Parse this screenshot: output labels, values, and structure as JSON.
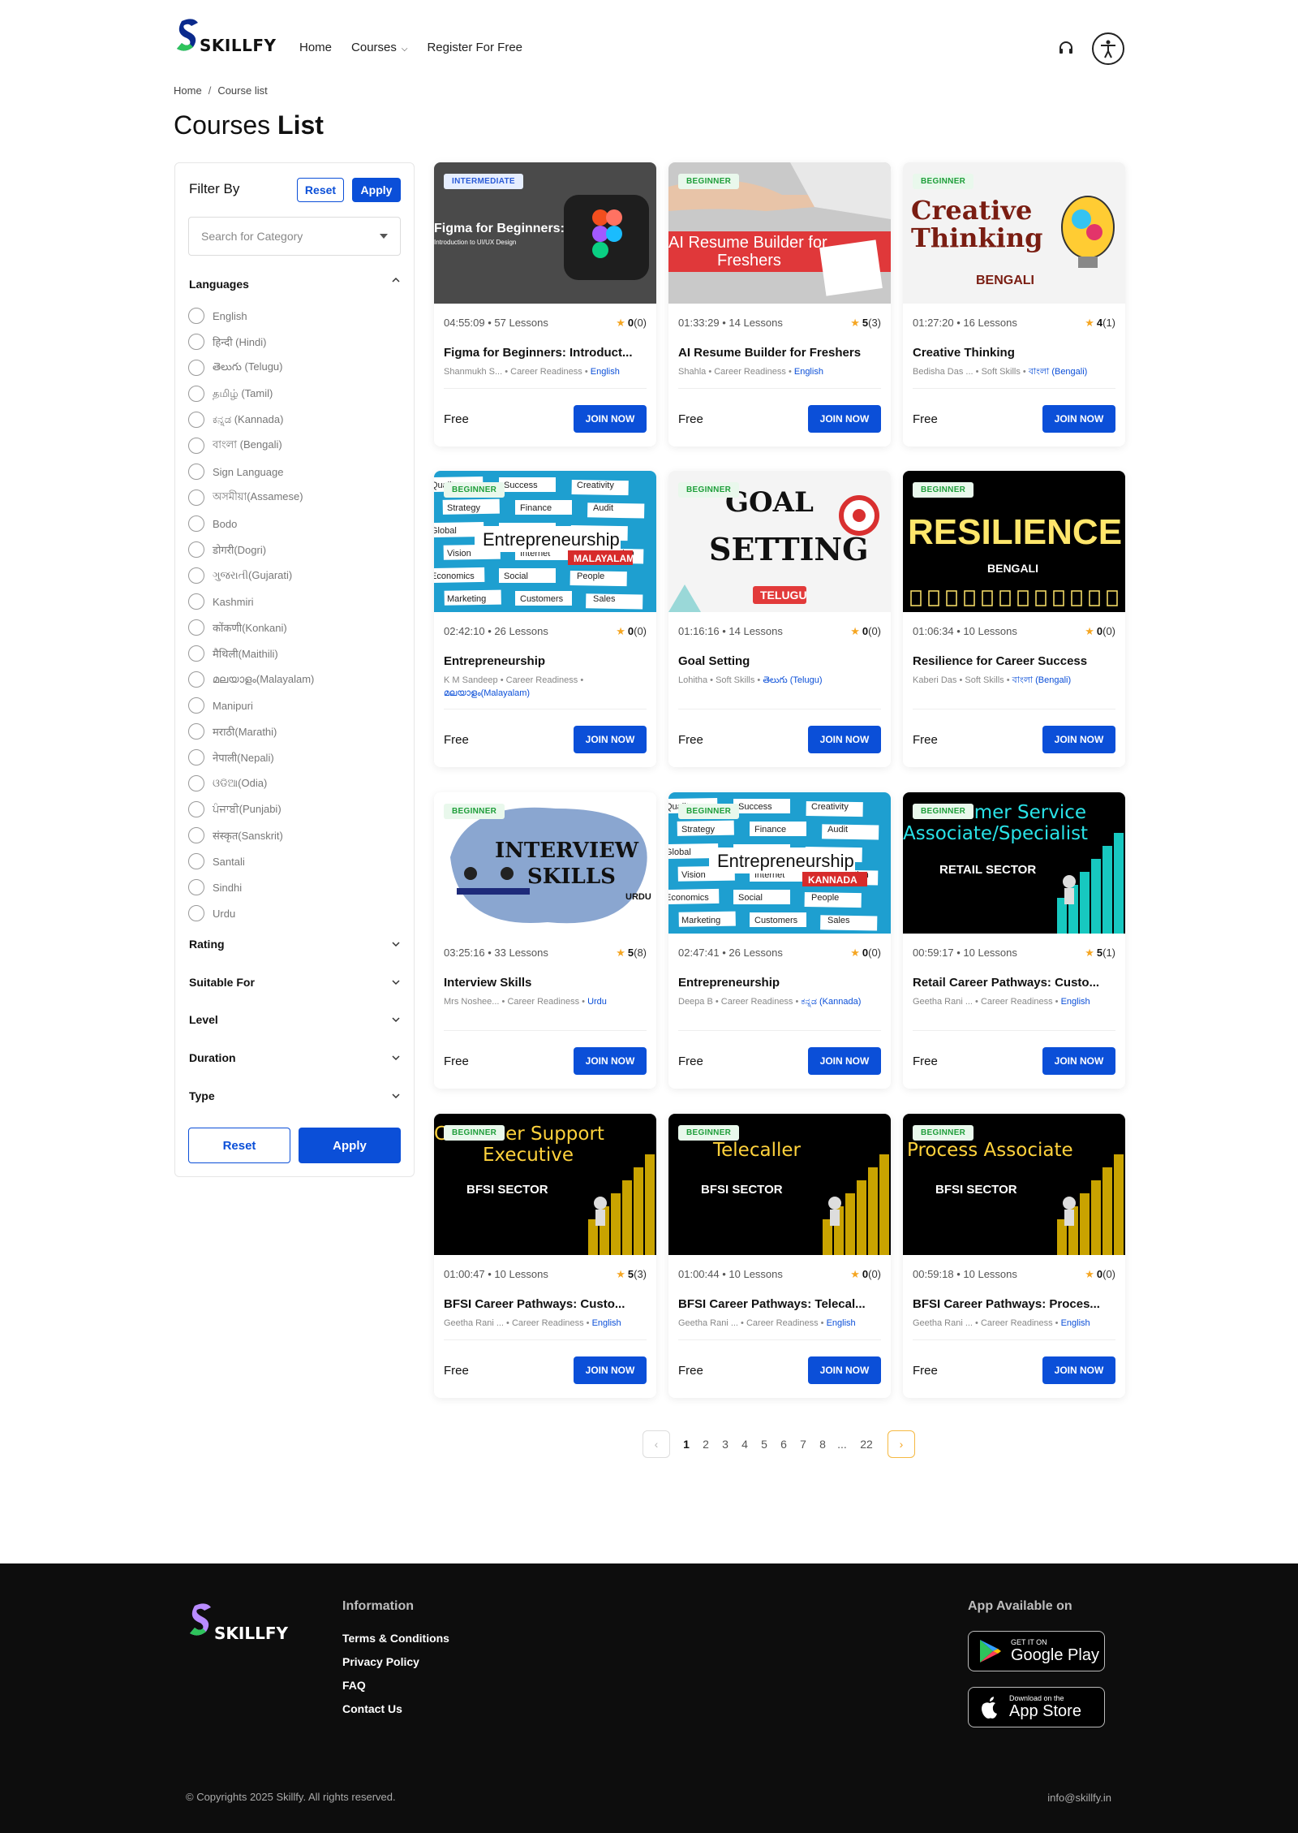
{
  "header": {
    "brand": "SKILLFY",
    "nav": [
      {
        "label": "Home"
      },
      {
        "label": "Courses"
      },
      {
        "label": "Register For Free"
      }
    ]
  },
  "breadcrumb": {
    "home": "Home",
    "current": "Course list"
  },
  "page_title": {
    "regular": "Courses",
    "bold": "List"
  },
  "filter": {
    "title": "Filter By",
    "reset": "Reset",
    "apply": "Apply",
    "category_placeholder": "Search for Category",
    "languages_title": "Languages",
    "languages": [
      "English",
      "हिन्दी (Hindi)",
      "తెలుగు (Telugu)",
      "தமிழ் (Tamil)",
      "ಕನ್ನಡ (Kannada)",
      "বাংলা (Bengali)",
      "Sign Language",
      "অসমীয়া(Assamese)",
      "Bodo",
      "डोगरी(Dogri)",
      "ગુજરાતી(Gujarati)",
      "Kashmiri",
      "कोंकणी(Konkani)",
      "मैथिली(Maithili)",
      "മലയാളം(Malayalam)",
      "Manipuri",
      "मराठी(Marathi)",
      "नेपाली(Nepali)",
      "ଓଡିଆ(Odia)",
      "ਪੰਜਾਬੀ(Punjabi)",
      "संस्कृत(Sanskrit)",
      "Santali",
      "Sindhi",
      "Urdu"
    ],
    "sections": [
      "Rating",
      "Suitable For",
      "Level",
      "Duration",
      "Type"
    ]
  },
  "courses": [
    {
      "level": "INTERMEDIATE",
      "duration": "04:55:09",
      "lessons": "57 Lessons",
      "rating": "0",
      "count": "(0)",
      "title": "Figma for Beginners: Introduct...",
      "author": "Shanmukh S...",
      "category": "Career Readiness",
      "language": "English",
      "price": "Free",
      "cta": "JOIN NOW",
      "thumb_text": "Figma for Beginners:",
      "thumb_sub": "Introduction to UI/UX Design"
    },
    {
      "level": "BEGINNER",
      "duration": "01:33:29",
      "lessons": "14 Lessons",
      "rating": "5",
      "count": "(3)",
      "title": "AI Resume Builder for Freshers",
      "author": "Shahla",
      "category": "Career Readiness",
      "language": "English",
      "price": "Free",
      "cta": "JOIN NOW",
      "thumb_text": "AI Resume Builder for",
      "thumb_sub": "Freshers"
    },
    {
      "level": "BEGINNER",
      "duration": "01:27:20",
      "lessons": "16 Lessons",
      "rating": "4",
      "count": "(1)",
      "title": "Creative Thinking",
      "author": "Bedisha Das ...",
      "category": "Soft Skills",
      "language": "বাংলা (Bengali)",
      "price": "Free",
      "cta": "JOIN NOW",
      "thumb_text": "Creative",
      "thumb_sub": "Thinking",
      "thumb_tag": "BENGALI"
    },
    {
      "level": "BEGINNER",
      "duration": "02:42:10",
      "lessons": "26 Lessons",
      "rating": "0",
      "count": "(0)",
      "title": "Entrepreneurship",
      "author": "K M Sandeep",
      "category": "Career Readiness",
      "language": "മലയാളം(Malayalam)",
      "price": "Free",
      "cta": "JOIN NOW",
      "thumb_text": "Entrepreneurship",
      "thumb_tag": "MALAYALAM"
    },
    {
      "level": "BEGINNER",
      "duration": "01:16:16",
      "lessons": "14 Lessons",
      "rating": "0",
      "count": "(0)",
      "title": "Goal Setting",
      "author": "Lohitha",
      "category": "Soft Skills",
      "language": "తెలుగు (Telugu)",
      "price": "Free",
      "cta": "JOIN NOW",
      "thumb_text": "GOAL",
      "thumb_sub": "SETTING",
      "thumb_tag": "TELUGU"
    },
    {
      "level": "BEGINNER",
      "duration": "01:06:34",
      "lessons": "10 Lessons",
      "rating": "0",
      "count": "(0)",
      "title": "Resilience for Career Success",
      "author": "Kaberi Das",
      "category": "Soft Skills",
      "language": "বাংলা (Bengali)",
      "price": "Free",
      "cta": "JOIN NOW",
      "thumb_text": "RESILIENCE",
      "thumb_tag": "BENGALI"
    },
    {
      "level": "BEGINNER",
      "duration": "03:25:16",
      "lessons": "33 Lessons",
      "rating": "5",
      "count": "(8)",
      "title": "Interview Skills",
      "author": "Mrs Noshee...",
      "category": "Career Readiness",
      "language": "Urdu",
      "price": "Free",
      "cta": "JOIN NOW",
      "thumb_text": "INTERVIEW",
      "thumb_sub": "SKILLS",
      "thumb_tag": "URDU"
    },
    {
      "level": "BEGINNER",
      "duration": "02:47:41",
      "lessons": "26 Lessons",
      "rating": "0",
      "count": "(0)",
      "title": "Entrepreneurship",
      "author": "Deepa B",
      "category": "Career Readiness",
      "language": "ಕನ್ನಡ (Kannada)",
      "price": "Free",
      "cta": "JOIN NOW",
      "thumb_text": "Entrepreneurship",
      "thumb_tag": "KANNADA"
    },
    {
      "level": "BEGINNER",
      "duration": "00:59:17",
      "lessons": "10 Lessons",
      "rating": "5",
      "count": "(1)",
      "title": "Retail Career Pathways: Custo...",
      "author": "Geetha Rani ...",
      "category": "Career Readiness",
      "language": "English",
      "price": "Free",
      "cta": "JOIN NOW",
      "thumb_text": "Customer Service",
      "thumb_sub": "Associate/Specialist",
      "thumb_tag": "RETAIL SECTOR"
    },
    {
      "level": "BEGINNER",
      "duration": "01:00:47",
      "lessons": "10 Lessons",
      "rating": "5",
      "count": "(3)",
      "title": "BFSI Career Pathways: Custo...",
      "author": "Geetha Rani ...",
      "category": "Career Readiness",
      "language": "English",
      "price": "Free",
      "cta": "JOIN NOW",
      "thumb_text": "Customer Support",
      "thumb_sub": "Executive",
      "thumb_tag": "BFSI SECTOR"
    },
    {
      "level": "BEGINNER",
      "duration": "01:00:44",
      "lessons": "10 Lessons",
      "rating": "0",
      "count": "(0)",
      "title": "BFSI Career Pathways: Telecal...",
      "author": "Geetha Rani ...",
      "category": "Career Readiness",
      "language": "English",
      "price": "Free",
      "cta": "JOIN NOW",
      "thumb_text": "Telecaller",
      "thumb_tag": "BFSI SECTOR"
    },
    {
      "level": "BEGINNER",
      "duration": "00:59:18",
      "lessons": "10 Lessons",
      "rating": "0",
      "count": "(0)",
      "title": "BFSI Career Pathways: Proces...",
      "author": "Geetha Rani ...",
      "category": "Career Readiness",
      "language": "English",
      "price": "Free",
      "cta": "JOIN NOW",
      "thumb_text": "Process Associate",
      "thumb_tag": "BFSI SECTOR"
    }
  ],
  "pagination": {
    "pages": [
      "1",
      "2",
      "3",
      "4",
      "5",
      "6",
      "7",
      "8",
      "...",
      "22"
    ],
    "current": "1"
  },
  "footer": {
    "brand": "SKILLFY",
    "info_title": "Information",
    "links": [
      "Terms & Conditions",
      "Privacy Policy",
      "FAQ",
      "Contact Us"
    ],
    "app_title": "App Available on",
    "google_small": "GET IT ON",
    "google_big": "Google Play",
    "apple_small": "Download on the",
    "apple_big": "App Store",
    "copyright": "© Copyrights 2025 Skillfy. All rights reserved.",
    "email": "info@skillfy.in"
  }
}
